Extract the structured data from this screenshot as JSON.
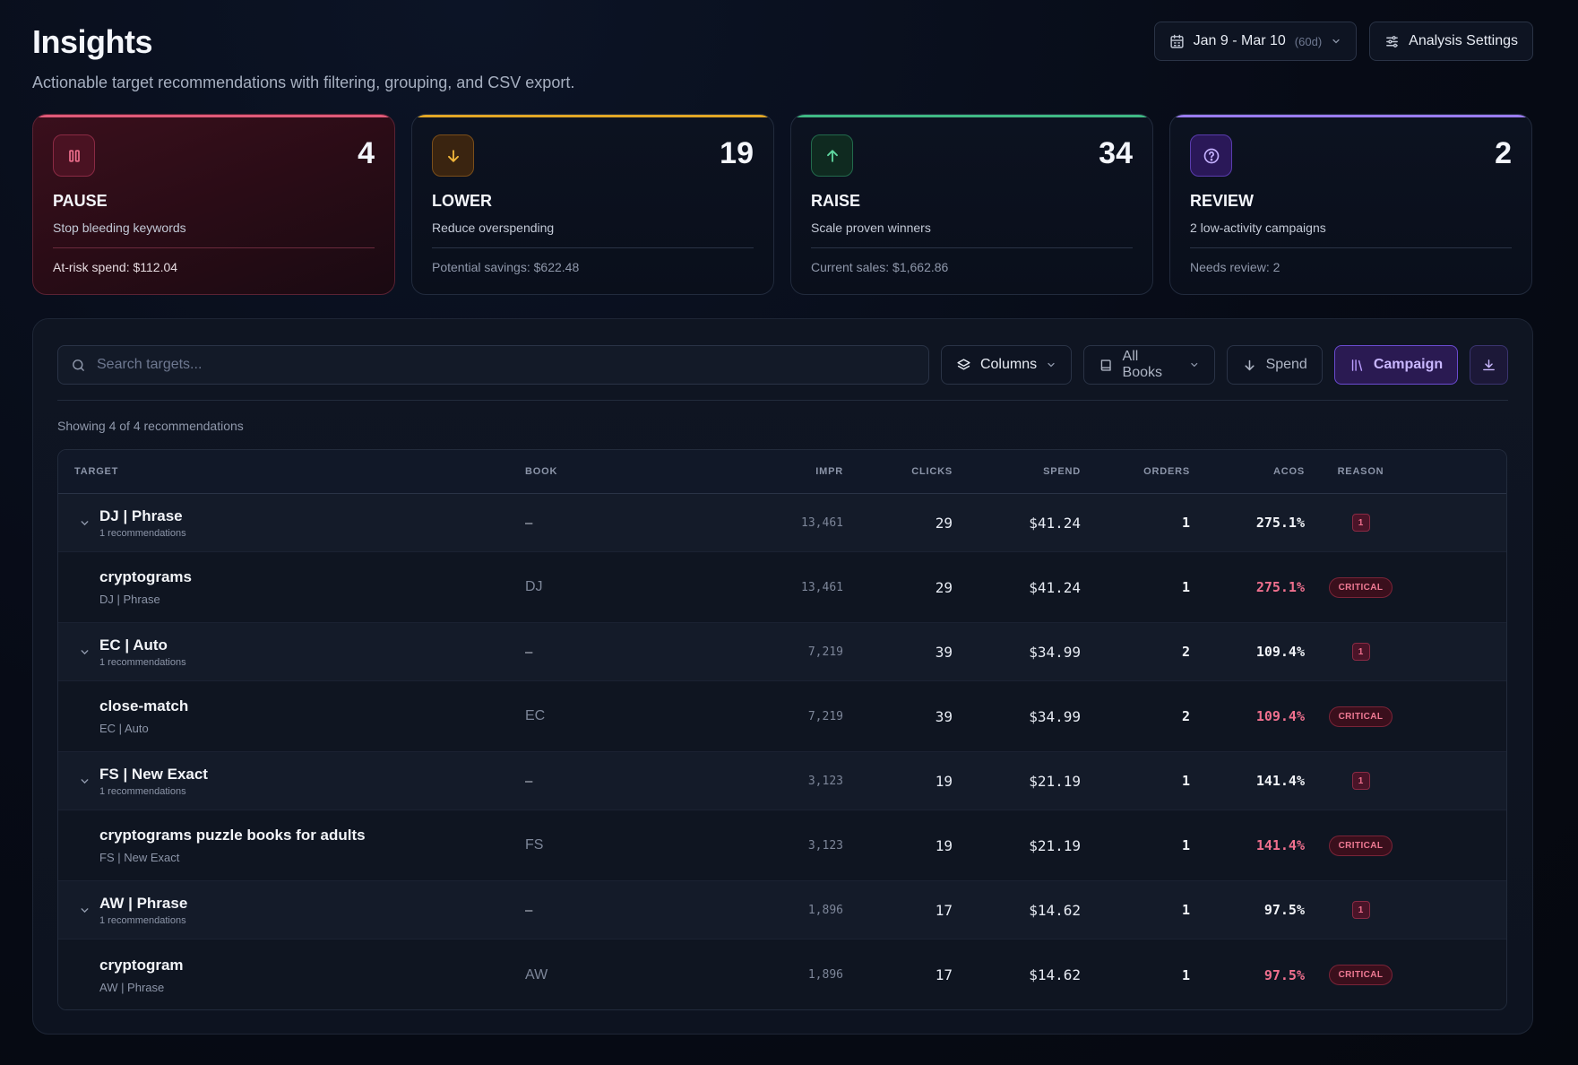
{
  "page": {
    "title": "Insights",
    "subtitle": "Actionable target recommendations with filtering, grouping, and CSV export."
  },
  "header": {
    "date_range": "Jan 9 - Mar 10",
    "date_span": "(60d)",
    "settings_label": "Analysis Settings"
  },
  "cards": [
    {
      "count": "4",
      "label": "PAUSE",
      "desc": "Stop bleeding keywords",
      "foot": "At-risk spend: $112.04",
      "icon": "pause-icon",
      "accent": "#e05a79"
    },
    {
      "count": "19",
      "label": "LOWER",
      "desc": "Reduce overspending",
      "foot": "Potential savings: $622.48",
      "icon": "arrow-down-icon",
      "accent": "#e2a726"
    },
    {
      "count": "34",
      "label": "RAISE",
      "desc": "Scale proven winners",
      "foot": "Current sales: $1,662.86",
      "icon": "arrow-up-icon",
      "accent": "#3fb984"
    },
    {
      "count": "2",
      "label": "REVIEW",
      "desc": "2 low-activity campaigns",
      "foot": "Needs review: 2",
      "icon": "help-circle-icon",
      "accent": "#9a7cf0"
    }
  ],
  "toolbar": {
    "search_placeholder": "Search targets...",
    "columns_label": "Columns",
    "books_label": "All Books",
    "sort_label": "Spend",
    "group_label": "Campaign"
  },
  "showing_text": "Showing 4 of 4 recommendations",
  "table": {
    "headers": {
      "target": "TARGET",
      "book": "BOOK",
      "impr": "IMPR",
      "clicks": "CLICKS",
      "spend": "SPEND",
      "orders": "ORDERS",
      "acos": "ACOS",
      "reason": "REASON"
    },
    "groups": [
      {
        "name": "DJ | Phrase",
        "sub": "1 recommendations",
        "book": "–",
        "impr": "13,461",
        "clicks": "29",
        "spend": "$41.24",
        "orders": "1",
        "acos": "275.1%",
        "count": "1",
        "item": {
          "name": "cryptograms",
          "sub": "DJ | Phrase",
          "book": "DJ",
          "impr": "13,461",
          "clicks": "29",
          "spend": "$41.24",
          "orders": "1",
          "acos": "275.1%",
          "reason": "CRITICAL"
        }
      },
      {
        "name": "EC | Auto",
        "sub": "1 recommendations",
        "book": "–",
        "impr": "7,219",
        "clicks": "39",
        "spend": "$34.99",
        "orders": "2",
        "acos": "109.4%",
        "count": "1",
        "item": {
          "name": "close-match",
          "sub": "EC | Auto",
          "book": "EC",
          "impr": "7,219",
          "clicks": "39",
          "spend": "$34.99",
          "orders": "2",
          "acos": "109.4%",
          "reason": "CRITICAL"
        }
      },
      {
        "name": "FS | New Exact",
        "sub": "1 recommendations",
        "book": "–",
        "impr": "3,123",
        "clicks": "19",
        "spend": "$21.19",
        "orders": "1",
        "acos": "141.4%",
        "count": "1",
        "item": {
          "name": "cryptograms puzzle books for adults",
          "sub": "FS | New Exact",
          "book": "FS",
          "impr": "3,123",
          "clicks": "19",
          "spend": "$21.19",
          "orders": "1",
          "acos": "141.4%",
          "reason": "CRITICAL"
        }
      },
      {
        "name": "AW | Phrase",
        "sub": "1 recommendations",
        "book": "–",
        "impr": "1,896",
        "clicks": "17",
        "spend": "$14.62",
        "orders": "1",
        "acos": "97.5%",
        "count": "1",
        "item": {
          "name": "cryptogram",
          "sub": "AW | Phrase",
          "book": "AW",
          "impr": "1,896",
          "clicks": "17",
          "spend": "$14.62",
          "orders": "1",
          "acos": "97.5%",
          "reason": "CRITICAL"
        }
      }
    ]
  }
}
